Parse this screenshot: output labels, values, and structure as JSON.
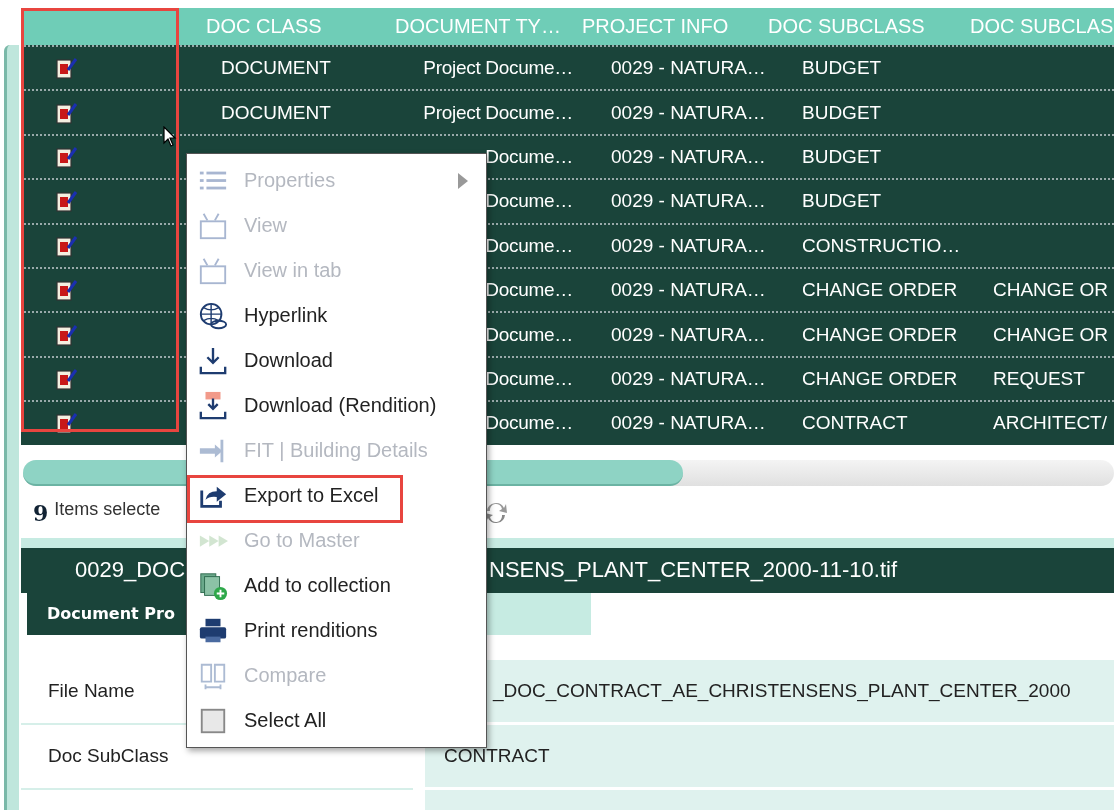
{
  "table": {
    "icon_column_highlighted": true,
    "columns": [
      "DOC CLASS",
      "DOCUMENT TY…",
      "PROJECT INFO",
      "DOC SUBCLASS",
      "DOC SUBCLAS"
    ],
    "rows": [
      {
        "selected": true,
        "cells": [
          "DOCUMENT",
          "Project Docume…",
          "0029 - NATURA…",
          "BUDGET",
          ""
        ]
      },
      {
        "selected": true,
        "cells": [
          "DOCUMENT",
          "Project Docume…",
          "0029 - NATURA…",
          "BUDGET",
          ""
        ]
      },
      {
        "selected": true,
        "cells": [
          "",
          "Docume…",
          "0029 - NATURA…",
          "BUDGET",
          ""
        ]
      },
      {
        "selected": true,
        "cells": [
          "",
          "Docume…",
          "0029 - NATURA…",
          "BUDGET",
          ""
        ]
      },
      {
        "selected": true,
        "cells": [
          "",
          "Docume…",
          "0029 - NATURA…",
          "CONSTRUCTIO…",
          ""
        ]
      },
      {
        "selected": true,
        "cells": [
          "",
          "Docume…",
          "0029 - NATURA…",
          "CHANGE ORDER",
          "CHANGE OR"
        ]
      },
      {
        "selected": true,
        "cells": [
          "",
          "Docume…",
          "0029 - NATURA…",
          "CHANGE ORDER",
          "CHANGE OR"
        ]
      },
      {
        "selected": true,
        "cells": [
          "",
          "Docume…",
          "0029 - NATURA…",
          "CHANGE ORDER",
          "REQUEST"
        ]
      },
      {
        "selected": true,
        "cells": [
          "",
          "Docume…",
          "0029 - NATURA…",
          "CONTRACT",
          "ARCHITECT/"
        ]
      }
    ]
  },
  "status": {
    "count": "9",
    "label": "Items selecte"
  },
  "document": {
    "title_parts": [
      "0029_DOC",
      "NSENS_PLANT_CENTER_2000-11-10.tif"
    ],
    "tab": "Document Pro",
    "properties": [
      {
        "label": "File Name",
        "value": "_DOC_CONTRACT_AE_CHRISTENSENS_PLANT_CENTER_2000"
      },
      {
        "label": "Doc SubClass",
        "value": "CONTRACT"
      }
    ]
  },
  "menu": {
    "items": [
      {
        "label": "Properties",
        "disabled": true,
        "submenu": true,
        "highlighted": false
      },
      {
        "label": "View",
        "disabled": true,
        "submenu": false,
        "highlighted": false
      },
      {
        "label": "View in tab",
        "disabled": true,
        "submenu": false,
        "highlighted": false
      },
      {
        "label": "Hyperlink",
        "disabled": false,
        "submenu": false,
        "highlighted": false
      },
      {
        "label": "Download",
        "disabled": false,
        "submenu": false,
        "highlighted": false
      },
      {
        "label": "Download (Rendition)",
        "disabled": false,
        "submenu": false,
        "highlighted": false
      },
      {
        "label": "FIT | Building Details",
        "disabled": true,
        "submenu": false,
        "highlighted": false
      },
      {
        "label": "Export to Excel",
        "disabled": false,
        "submenu": false,
        "highlighted": true
      },
      {
        "label": "Go to Master",
        "disabled": true,
        "submenu": false,
        "highlighted": false
      },
      {
        "label": "Add to collection",
        "disabled": false,
        "submenu": false,
        "highlighted": false
      },
      {
        "label": "Print renditions",
        "disabled": false,
        "submenu": false,
        "highlighted": false
      },
      {
        "label": "Compare",
        "disabled": true,
        "submenu": false,
        "highlighted": false
      },
      {
        "label": "Select All",
        "disabled": false,
        "submenu": false,
        "highlighted": false
      }
    ]
  }
}
